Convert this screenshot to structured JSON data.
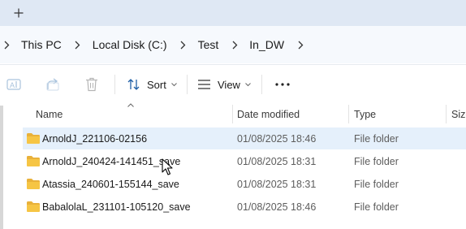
{
  "tabbar": {
    "new_tab_icon": "plus-icon"
  },
  "breadcrumb": {
    "items": [
      "This PC",
      "Local Disk (C:)",
      "Test",
      "In_DW"
    ]
  },
  "toolbar": {
    "rename_icon": "rename-icon",
    "share_icon": "share-icon",
    "delete_icon": "trash-icon",
    "sort_label": "Sort",
    "view_label": "View",
    "more_icon": "more-options-icon"
  },
  "columns": {
    "name": "Name",
    "date_modified": "Date modified",
    "type": "Type",
    "size": "Size"
  },
  "files": [
    {
      "name": "ArnoldJ_221106-02156",
      "date": "01/08/2025 18:46",
      "type": "File folder",
      "selected": true
    },
    {
      "name": "ArnoldJ_240424-141451_save",
      "date": "01/08/2025 18:31",
      "type": "File folder",
      "selected": false
    },
    {
      "name": "Atassia_240601-155144_save",
      "date": "01/08/2025 18:31",
      "type": "File folder",
      "selected": false
    },
    {
      "name": "BabalolaL_231101-105120_save",
      "date": "01/08/2025 18:46",
      "type": "File folder",
      "selected": false
    }
  ],
  "colors": {
    "selection": "#e5f0fb",
    "folder": "#f6c544",
    "tab_strip": "#dfe8f4"
  }
}
